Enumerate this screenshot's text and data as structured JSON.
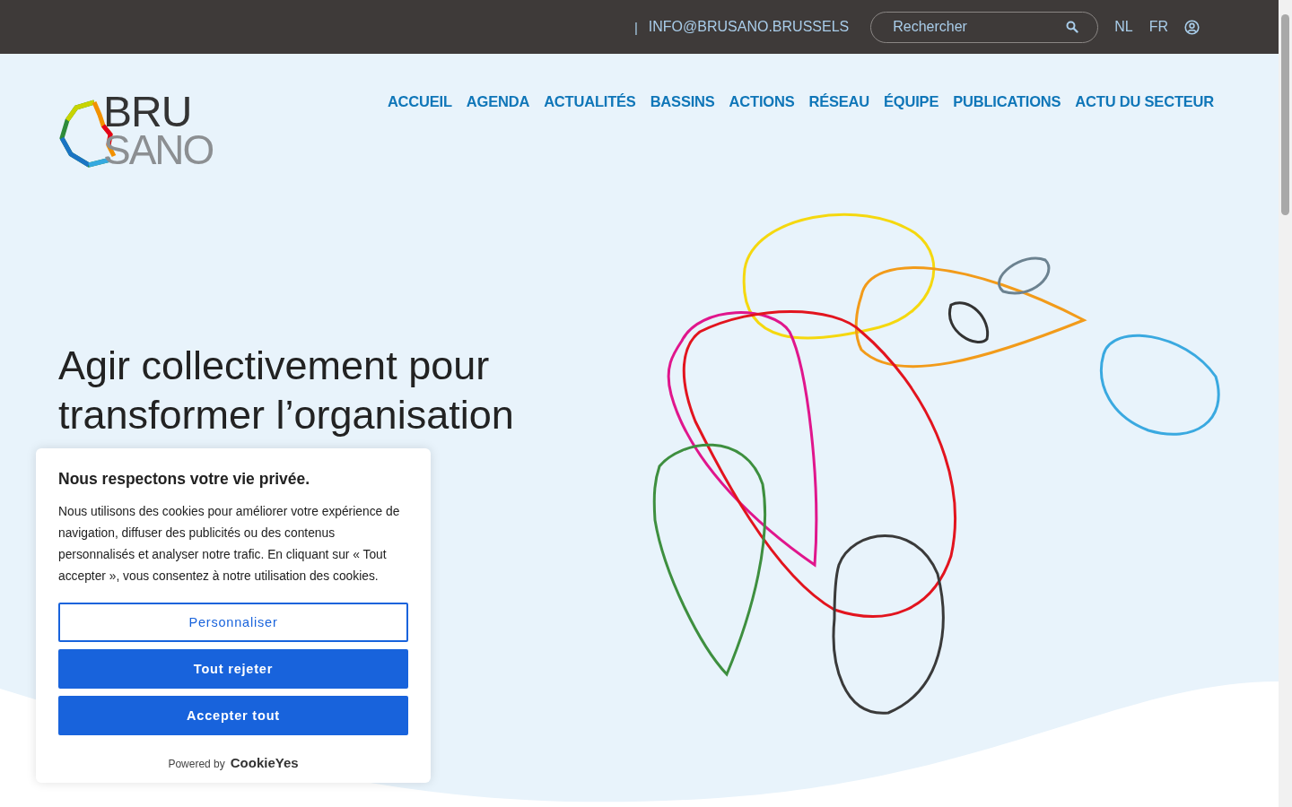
{
  "top_bar": {
    "separator": "|",
    "email": "INFO@BRUSANO.BRUSSELS",
    "search": {
      "placeholder": "Rechercher"
    },
    "languages": [
      "NL",
      "FR"
    ]
  },
  "logo": {
    "line_1": "BRU",
    "line_2": "SANO"
  },
  "nav": [
    "ACCUEIL",
    "AGENDA",
    "ACTUALITÉS",
    "BASSINS",
    "ACTIONS",
    "RÉSEAU",
    "ÉQUIPE",
    "PUBLICATIONS",
    "ACTU DU SECTEUR"
  ],
  "hero": {
    "heading": "Agir collectivement pour transformer l’organisation"
  },
  "cookie_banner": {
    "title": "Nous respectons votre vie privée.",
    "text": "Nous utilisons des cookies pour améliorer votre expérience de navigation, diffuser des publicités ou des contenus personnalisés et analyser notre trafic. En cliquant sur « Tout accepter », vous consentez à notre utilisation des cookies.",
    "buttons": [
      {
        "label": "Personnaliser",
        "kind": "outline"
      },
      {
        "label": "Tout rejeter",
        "kind": "filled"
      },
      {
        "label": "Accepter tout",
        "kind": "filled"
      }
    ],
    "powered_by": "Powered by",
    "brand": "CookieYes"
  }
}
